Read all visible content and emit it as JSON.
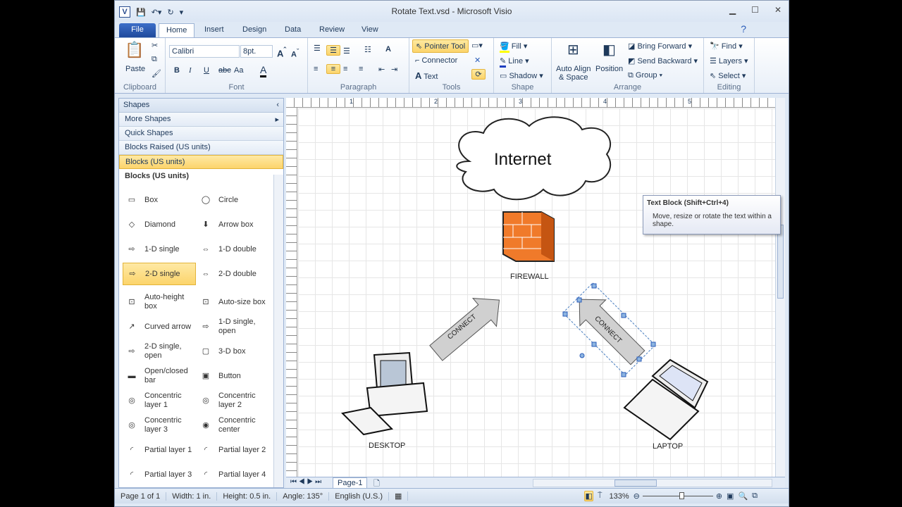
{
  "window": {
    "title": "Rotate Text.vsd  -  Microsoft Visio",
    "logo": "V"
  },
  "tabs": [
    "File",
    "Home",
    "Insert",
    "Design",
    "Data",
    "Review",
    "View"
  ],
  "ribbon": {
    "clipboard": {
      "label": "Clipboard",
      "paste": "Paste"
    },
    "font": {
      "label": "Font",
      "family": "Calibri",
      "size": "8pt.",
      "bold": "B",
      "italic": "I",
      "underline": "U",
      "strike": "abc",
      "case": "Aa"
    },
    "paragraph": {
      "label": "Paragraph"
    },
    "tools": {
      "label": "Tools",
      "pointer": "Pointer Tool",
      "connector": "Connector",
      "text": "Text"
    },
    "shape": {
      "label": "Shape",
      "fill": "Fill",
      "line": "Line",
      "shadow": "Shadow"
    },
    "arrange": {
      "label": "Arrange",
      "auto_align": "Auto Align",
      "auto_align2": "& Space",
      "position": "Position",
      "bring_forward": "Bring Forward",
      "send_backward": "Send Backward",
      "group": "Group"
    },
    "editing": {
      "label": "Editing",
      "find": "Find",
      "layers": "Layers",
      "select": "Select"
    }
  },
  "tooltip": {
    "title": "Text Block (Shift+Ctrl+4)",
    "body": "Move, resize or rotate the text within a shape."
  },
  "shapes_panel": {
    "header": "Shapes",
    "more": "More Shapes",
    "stencils": [
      "Quick Shapes",
      "Blocks Raised (US units)",
      "Blocks (US units)"
    ],
    "stencil_title": "Blocks (US units)",
    "items": [
      "Box",
      "Circle",
      "Diamond",
      "Arrow box",
      "1-D single",
      "1-D double",
      "2-D single",
      "2-D double",
      "Auto-height box",
      "Auto-size box",
      "Curved arrow",
      "1-D single, open",
      "2-D single, open",
      "3-D box",
      "Open/closed bar",
      "Button",
      "Concentric layer 1",
      "Concentric layer 2",
      "Concentric layer 3",
      "Concentric center",
      "Partial layer 1",
      "Partial layer 2",
      "Partial layer 3",
      "Partial layer 4"
    ]
  },
  "diagram": {
    "internet": "Internet",
    "firewall": "FIREWALL",
    "desktop": "DESKTOP",
    "laptop": "LAPTOP",
    "connect1": "CONNECT",
    "connect2": "CONNECT"
  },
  "ruler": {
    "marks": [
      "1",
      "2",
      "3",
      "4",
      "5"
    ]
  },
  "page_tab": "Page-1",
  "status": {
    "page": "Page 1 of 1",
    "width": "Width: 1 in.",
    "height": "Height: 0.5 in.",
    "angle": "Angle: 135°",
    "language": "English (U.S.)",
    "zoom": "133%"
  },
  "colors": {
    "accent": "#fcd46b",
    "firewall": "#f07a2a",
    "file_tab": "#2a5bb8"
  }
}
